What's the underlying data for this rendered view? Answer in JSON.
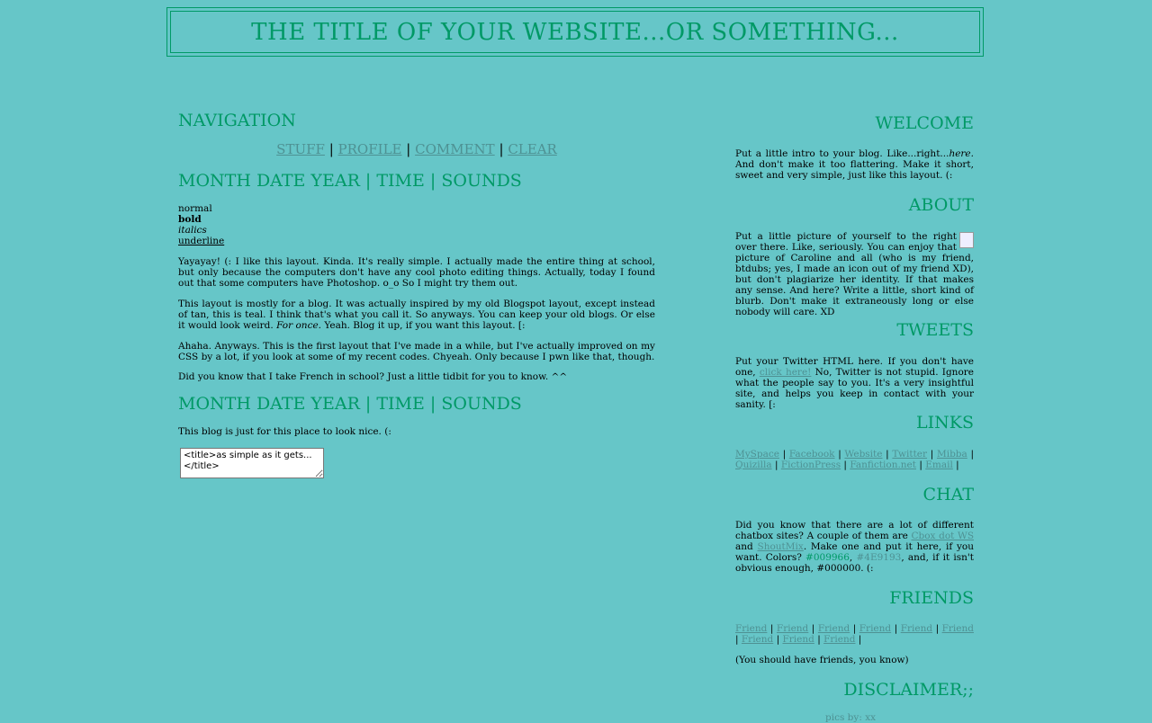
{
  "site_title": "THE TITLE OF YOUR WEBSITE...OR SOMETHING...",
  "left": {
    "nav_heading": "NAVIGATION",
    "nav_links": [
      "STUFF",
      "PROFILE",
      "COMMENT",
      "CLEAR"
    ],
    "nav_sep": "|",
    "posts": [
      {
        "heading": "MONTH DATE YEAR | TIME | SOUNDS",
        "styles": {
          "normal": "normal",
          "bold": "bold",
          "italics": "italics",
          "underline": "underline"
        },
        "p1": "Yayayay! (: I like this layout. Kinda. It's really simple. I actually made the entire thing at school, but only because the computers don't have any cool photo editing things. Actually, today I found out that some computers have Photoshop. o_o So I might try them out.",
        "p2a": "This layout is mostly for a blog. It was actually inspired by my old Blogspot layout, except instead of tan, this is teal. I think that's what you call it. So anyways. You can keep your old blogs. Or else it would look weird. ",
        "p2b": "For once.",
        "p2c": " Yeah. Blog it up, if you want this layout. [:",
        "p3": "Ahaha. Anyways. This is the first layout that I've made in a while, but I've actually improved on my CSS by a lot, if you look at some of my recent codes. Chyeah. Only because I pwn like that, though.",
        "p4": "Did you know that I take French in school? Just a little tidbit for you to know. ^^"
      },
      {
        "heading": "MONTH DATE YEAR | TIME | SOUNDS",
        "p1": "This blog is just for this place to look nice. (:",
        "textarea": "<title>as simple as it gets...</title>"
      }
    ]
  },
  "right": {
    "welcome": {
      "heading": "WELCOME",
      "t1": "Put a little intro to your blog. Like...right...",
      "t2": "here.",
      "t3": " And don't make it too flattering. Make it short, sweet and very simple, just like this layout. (:"
    },
    "about": {
      "heading": "ABOUT",
      "text": "Put a little picture of yourself to the right over there. Like, seriously. You can enjoy that picture of Caroline and all (who is my friend, btdubs; yes, I made an icon out of my friend XD), but don't plagiarize her identity. If that makes any sense. And here? Write a little, short kind of blurb. Don't make it extraneously long or else nobody will care. XD"
    },
    "tweets": {
      "heading": "TWEETS",
      "t1": "Put your Twitter HTML here. If you don't have one, ",
      "link": "click here!",
      "t2": " No, Twitter is not stupid. Ignore what the people say to you. It's a very insightful site, and helps you keep in contact with your sanity. [:"
    },
    "links": {
      "heading": "LINKS",
      "items": [
        "MySpace",
        "Facebook",
        "Website",
        "Twitter",
        "Mibba",
        "Quizilla",
        "FictionPress",
        "Fanfiction.net",
        "Email"
      ]
    },
    "chat": {
      "heading": "CHAT",
      "t1": "Did you know that there are a lot of different chatbox sites? A couple of them are ",
      "link1": "Cbox dot WS",
      "t2": " and ",
      "link2": "ShoutMix",
      "t3": ". Make one and put it here, if you want. Colors? ",
      "c1": "#009966",
      "t4": ", ",
      "c2": "#4E9193",
      "t5": ", and, if it isn't obvious enough, #000000. (:"
    },
    "friends": {
      "heading": "FRIENDS",
      "items": [
        "Friend",
        "Friend",
        "Friend",
        "Friend",
        "Friend",
        "Friend",
        "Friend",
        "Friend",
        "Friend"
      ],
      "note": "(You should have friends, you know)"
    },
    "disclaimer": {
      "heading": "DISCLAIMER;;",
      "text": "pics by: xx"
    }
  },
  "colors": {
    "background": "#66c6c8",
    "accent": "#009966",
    "link": "#4e9193",
    "text": "#000000"
  }
}
